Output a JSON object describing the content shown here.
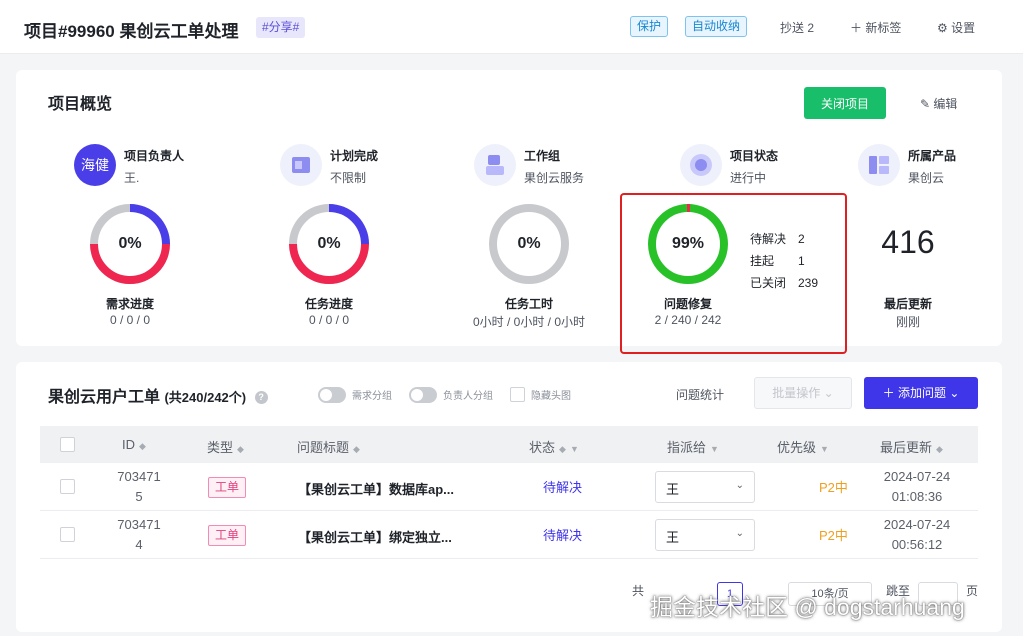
{
  "header": {
    "title": "项目#99960 果创云工单处理",
    "share_tag": "#分享#",
    "badge_protect": "保护",
    "badge_autoclose": "自动收纳",
    "cc": "抄送 2",
    "new_tag": "新标签",
    "settings": "设置"
  },
  "overview": {
    "title": "项目概览",
    "close_button": "关闭项目",
    "edit_label": "编辑",
    "meta": [
      {
        "label": "项目负责人",
        "value": "王.",
        "icon": "avatar-海健",
        "avatar_text": "海健"
      },
      {
        "label": "计划完成",
        "value": "不限制",
        "icon": "calendar-icon"
      },
      {
        "label": "工作组",
        "value": "果创云服务",
        "icon": "team-icon"
      },
      {
        "label": "项目状态",
        "value": "进行中",
        "icon": "status-icon"
      },
      {
        "label": "所属产品",
        "value": "果创云",
        "icon": "product-icon"
      }
    ],
    "stats": [
      {
        "percent": "0%",
        "label": "需求进度",
        "sub": "0 / 0 / 0",
        "fill": 0.5
      },
      {
        "percent": "0%",
        "label": "任务进度",
        "sub": "0 / 0 / 0",
        "fill": 0.5
      },
      {
        "percent": "0%",
        "label": "任务工时",
        "sub": "0小时 / 0小时 / 0小时",
        "fill": 0
      },
      {
        "percent": "99%",
        "label": "问题修复",
        "sub": "2 / 240 / 242",
        "fill": 0.99
      }
    ],
    "issue_legend": [
      {
        "label": "待解决",
        "value": "2"
      },
      {
        "label": "挂起",
        "value": "1"
      },
      {
        "label": "已关闭",
        "value": "239"
      }
    ],
    "last_update": {
      "number": "416",
      "label": "最后更新",
      "sub": "刚刚"
    },
    "colors": {
      "ring_blue": "#4a3ee8",
      "ring_red": "#ef2750",
      "ring_grey": "#c8c9cc",
      "ring_green": "#28c228",
      "highlight": "#e02020"
    }
  },
  "tickets": {
    "title": "果创云用户工单",
    "count": "(共240/242个)",
    "toggle_req": "需求分组",
    "toggle_owner": "负责人分组",
    "hide_avatar": "隐藏头图",
    "stats_link": "问题统计",
    "batch_button": "批量操作",
    "add_button": "添加问题",
    "columns": [
      "ID",
      "类型",
      "问题标题",
      "状态",
      "指派给",
      "优先级",
      "最后更新"
    ],
    "rows": [
      {
        "id": "703471\n5",
        "type": "工单",
        "title": "【果创云工单】数据库ap...",
        "status": "待解决",
        "assignee": "王",
        "priority": "P2中",
        "updated": "2024-07-24\n01:08:36"
      },
      {
        "id": "703471\n4",
        "type": "工单",
        "title": "【果创云工单】绑定独立...",
        "status": "待解决",
        "assignee": "王",
        "priority": "P2中",
        "updated": "2024-07-24\n00:56:12"
      }
    ],
    "pager": {
      "total_prefix": "共",
      "page": "1",
      "page_size": "10条/页",
      "jump": "跳至",
      "page_suffix": "页"
    }
  },
  "watermark": "掘金技术社区 @ dogstarhuang"
}
